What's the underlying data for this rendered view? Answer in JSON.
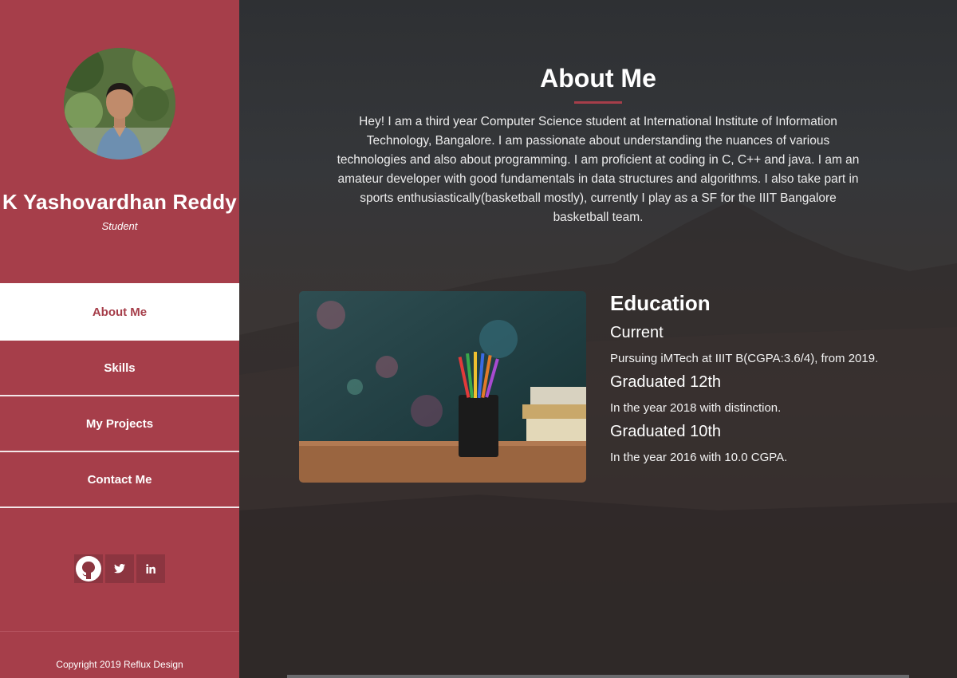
{
  "profile": {
    "name": "K Yashovardhan Reddy",
    "role": "Student"
  },
  "nav": {
    "items": [
      "About Me",
      "Skills",
      "My Projects",
      "Contact Me"
    ],
    "active": "About Me"
  },
  "socials": [
    "github-icon",
    "twitter-icon",
    "linkedin-icon"
  ],
  "footer": {
    "copyright": "Copyright 2019 Reflux Design"
  },
  "about": {
    "title": "About Me",
    "intro": "Hey! I am a third year Computer Science student at International Institute of Information Technology, Bangalore. I am passionate about understanding the nuances of various technologies and also about programming. I am proficient at coding in C, C++ and java. I am an amateur developer with good fundamentals in data structures and algorithms. I also take part in sports enthusiastically(basketball mostly), currently I play as a SF for the IIIT Bangalore basketball team."
  },
  "education": {
    "heading": "Education",
    "entries": [
      {
        "title": "Current",
        "detail": "Pursuing iMTech at IIIT B(CGPA:3.6/4), from 2019."
      },
      {
        "title": "Graduated 12th",
        "detail": "In the year 2018 with distinction."
      },
      {
        "title": "Graduated 10th",
        "detail": "In the year 2016 with 10.0 CGPA."
      }
    ]
  },
  "colors": {
    "accent": "#a63e4a",
    "sidebar": "#a63e4a",
    "social_bg": "#8c3540"
  }
}
